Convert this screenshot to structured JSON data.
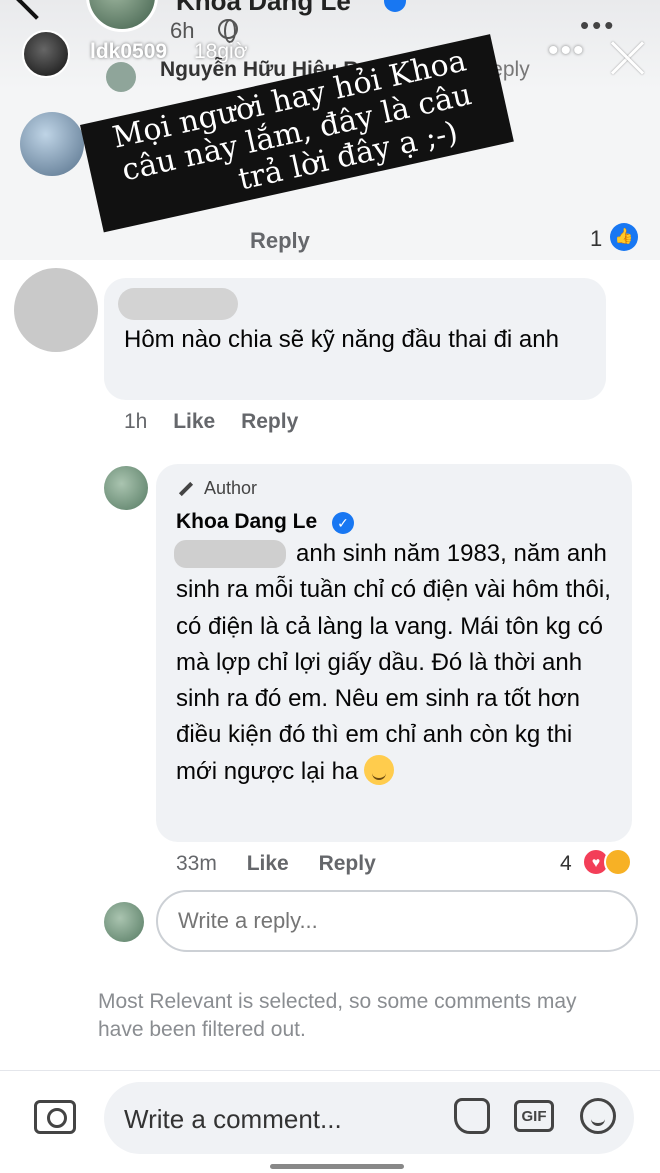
{
  "post": {
    "author": "Khoa Dang Le",
    "time": "6h"
  },
  "story": {
    "username": "ldk0509",
    "time": "18giờ",
    "more_label": "•••"
  },
  "hidden_reply": {
    "text": "Nguyễn Hữu Hiệu Replied · ...",
    "right_text": "Reply"
  },
  "top_comment": {
    "reply_label": "Reply",
    "like_count": "1"
  },
  "sticker": {
    "lines": [
      "Mọi người hay hỏi Khoa",
      "câu này lắm, đây là câu",
      "trả lời đây ạ ;-)"
    ]
  },
  "comment": {
    "text": "Hôm nào chia sẽ kỹ năng đầu thai đi anh",
    "time": "1h",
    "like_label": "Like",
    "reply_label": "Reply"
  },
  "author_reply": {
    "badge": "Author",
    "author": "Khoa Dang Le",
    "text": "anh sinh năm 1983, năm anh sinh ra mỗi tuần chỉ có điện vài hôm thôi, có điện là cả làng la vang. Mái tôn kg có mà lợp chỉ lợi giấy dầu. Đó là thời anh sinh ra đó em. Nêu em sinh ra tốt hơn điều kiện đó thì em chỉ anh còn kg thi mới ngược lại ha",
    "time": "33m",
    "like_label": "Like",
    "reply_label": "Reply",
    "reaction_count": "4"
  },
  "reply_box": {
    "placeholder": "Write a reply..."
  },
  "filter_note": "Most Relevant is selected, so some comments may have been filtered out.",
  "composer": {
    "placeholder": "Write a comment..."
  },
  "icons": {
    "accent": "#1877f2",
    "love": "#f33e58",
    "care": "#f7b125"
  }
}
